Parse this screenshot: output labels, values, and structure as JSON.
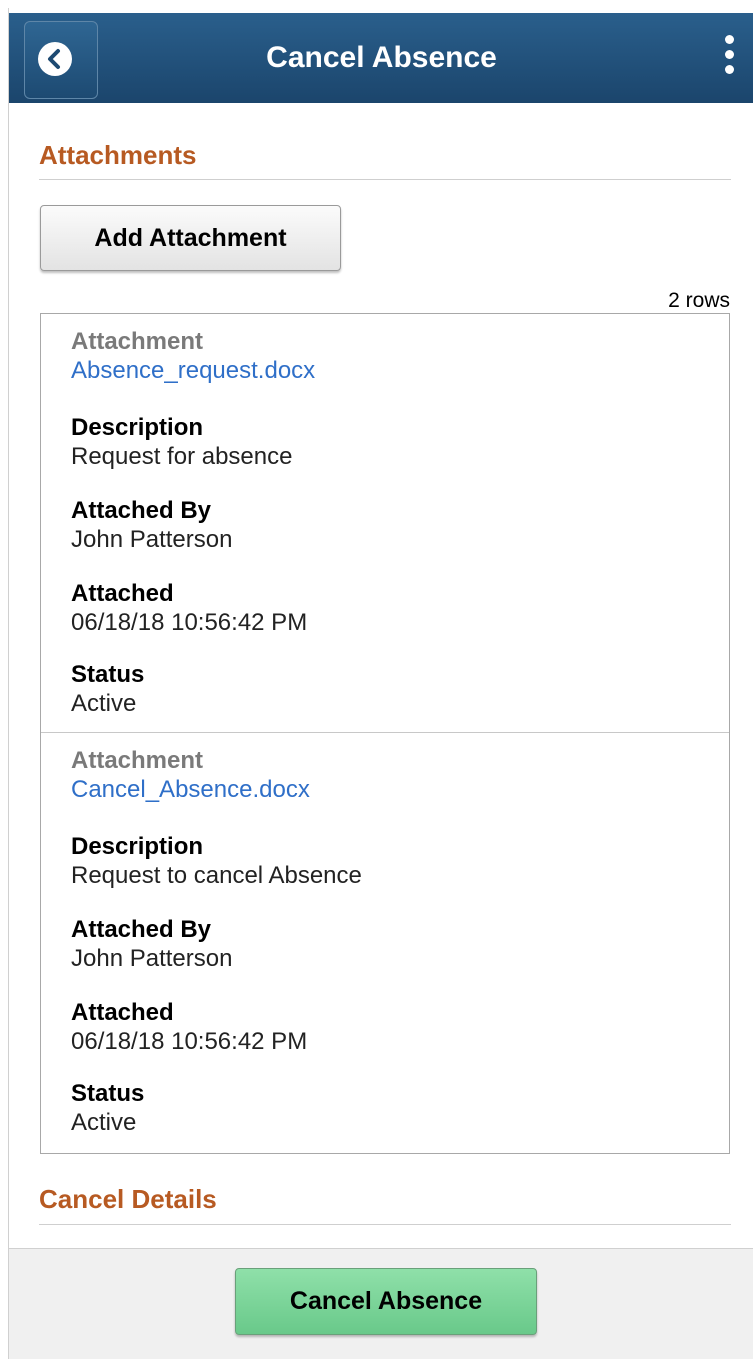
{
  "header": {
    "title": "Cancel Absence",
    "back_icon": "chevron-left-icon",
    "menu_icon": "kebab-menu-icon"
  },
  "attachments_section": {
    "title": "Attachments",
    "add_button_label": "Add Attachment",
    "row_count": "2 rows",
    "records": [
      {
        "attachment_label": "Attachment",
        "attachment_file": "Absence_request.docx",
        "description_label": "Description",
        "description": "Request for absence",
        "attached_by_label": "Attached By",
        "attached_by": "John Patterson",
        "attached_label": "Attached",
        "attached": "06/18/18 10:56:42 PM",
        "status_label": "Status",
        "status": "Active"
      },
      {
        "attachment_label": "Attachment",
        "attachment_file": "Cancel_Absence.docx",
        "description_label": "Description",
        "description": "Request to cancel Absence",
        "attached_by_label": "Attached By",
        "attached_by": "John Patterson",
        "attached_label": "Attached",
        "attached": "06/18/18 10:56:42 PM",
        "status_label": "Status",
        "status": "Active"
      }
    ]
  },
  "cancel_details_section": {
    "title": "Cancel Details"
  },
  "footer": {
    "cancel_button_label": "Cancel Absence"
  },
  "colors": {
    "header_bg": "#1b456c",
    "section_title": "#b75a22",
    "link": "#2f6fc8",
    "primary_button": "#69c98a"
  }
}
